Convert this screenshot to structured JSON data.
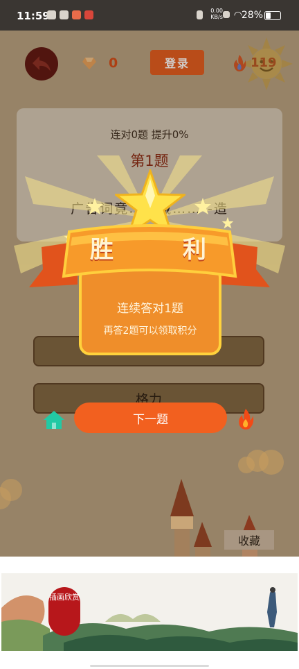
{
  "status_bar": {
    "time": "11:59",
    "net_speed_value": "0.00",
    "net_speed_unit": "KB/s",
    "battery": "28%"
  },
  "header": {
    "diamond_count": "0",
    "login_label": "登录",
    "fire_count": "119"
  },
  "question": {
    "stats": "连对0题 提升0%",
    "number": "第1题",
    "text_partial": "广告词竟……藏……--造"
  },
  "options": [
    "",
    "格力"
  ],
  "victory": {
    "title_chars": [
      "胜",
      "利"
    ],
    "line1": "连续答对1题",
    "line2": "再答2题可以领取积分"
  },
  "actions": {
    "next_label": "下一题",
    "collect_label": "收藏"
  },
  "ad": {
    "stamp_text": "插画欣赏"
  },
  "colors": {
    "accent": "#f2601f",
    "panel": "#ef8e2a",
    "panel_border": "#ffd23c",
    "back_button": "#5d1410",
    "question_number": "#8a2813"
  }
}
